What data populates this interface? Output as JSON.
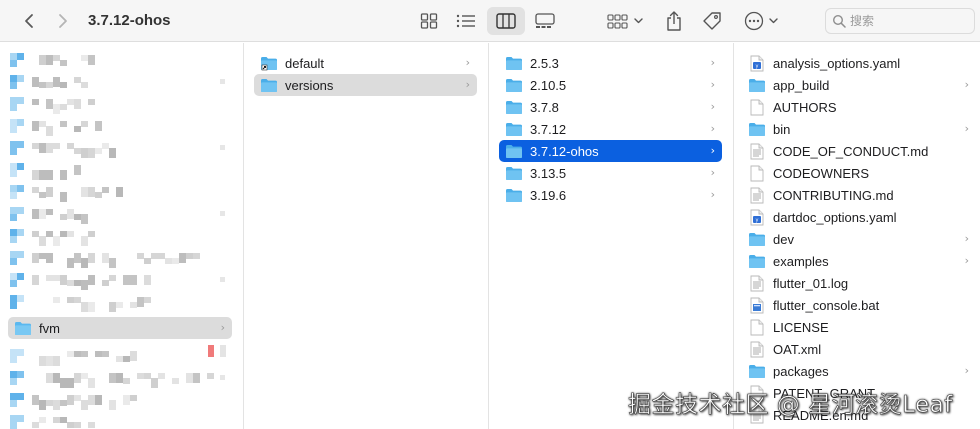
{
  "window": {
    "title": "3.7.12-ohos"
  },
  "search": {
    "placeholder": "搜索"
  },
  "sidebar": {
    "selected": {
      "label": "fvm"
    }
  },
  "column1": {
    "items": [
      {
        "label": "default",
        "icon": "folder-alias-icon",
        "chevron": true
      },
      {
        "label": "versions",
        "icon": "folder-icon",
        "chevron": true,
        "selected": "grey"
      }
    ]
  },
  "column2": {
    "items": [
      {
        "label": "2.5.3",
        "chevron": true
      },
      {
        "label": "2.10.5",
        "chevron": true
      },
      {
        "label": "3.7.8",
        "chevron": true
      },
      {
        "label": "3.7.12",
        "chevron": true
      },
      {
        "label": "3.7.12-ohos",
        "chevron": true,
        "selected": "blue"
      },
      {
        "label": "3.13.5",
        "chevron": true
      },
      {
        "label": "3.19.6",
        "chevron": true
      }
    ]
  },
  "column3": {
    "items": [
      {
        "label": "analysis_options.yaml",
        "icon": "yaml-file-icon",
        "chevron": false
      },
      {
        "label": "app_build",
        "icon": "folder-icon",
        "chevron": true
      },
      {
        "label": "AUTHORS",
        "icon": "document-icon",
        "chevron": false
      },
      {
        "label": "bin",
        "icon": "folder-icon",
        "chevron": true
      },
      {
        "label": "CODE_OF_CONDUCT.md",
        "icon": "text-file-icon",
        "chevron": false
      },
      {
        "label": "CODEOWNERS",
        "icon": "document-icon",
        "chevron": false
      },
      {
        "label": "CONTRIBUTING.md",
        "icon": "text-file-icon",
        "chevron": false
      },
      {
        "label": "dartdoc_options.yaml",
        "icon": "yaml-file-icon",
        "chevron": false
      },
      {
        "label": "dev",
        "icon": "folder-icon",
        "chevron": true
      },
      {
        "label": "examples",
        "icon": "folder-icon",
        "chevron": true
      },
      {
        "label": "flutter_01.log",
        "icon": "text-file-icon",
        "chevron": false
      },
      {
        "label": "flutter_console.bat",
        "icon": "bat-file-icon",
        "chevron": false
      },
      {
        "label": "LICENSE",
        "icon": "document-icon",
        "chevron": false
      },
      {
        "label": "OAT.xml",
        "icon": "text-file-icon",
        "chevron": false
      },
      {
        "label": "packages",
        "icon": "folder-icon",
        "chevron": true
      },
      {
        "label": "PATENT_GRANT",
        "icon": "document-icon",
        "chevron": false
      },
      {
        "label": "README.en.md",
        "icon": "text-file-icon",
        "chevron": false
      }
    ]
  },
  "watermark": {
    "text": "掘金技术社区 @ 星河滚烫Leaf"
  },
  "colors": {
    "selection_blue": "#0b60e0",
    "selection_grey": "#dcdcdc",
    "folder_blue": "#5ab8ef"
  }
}
